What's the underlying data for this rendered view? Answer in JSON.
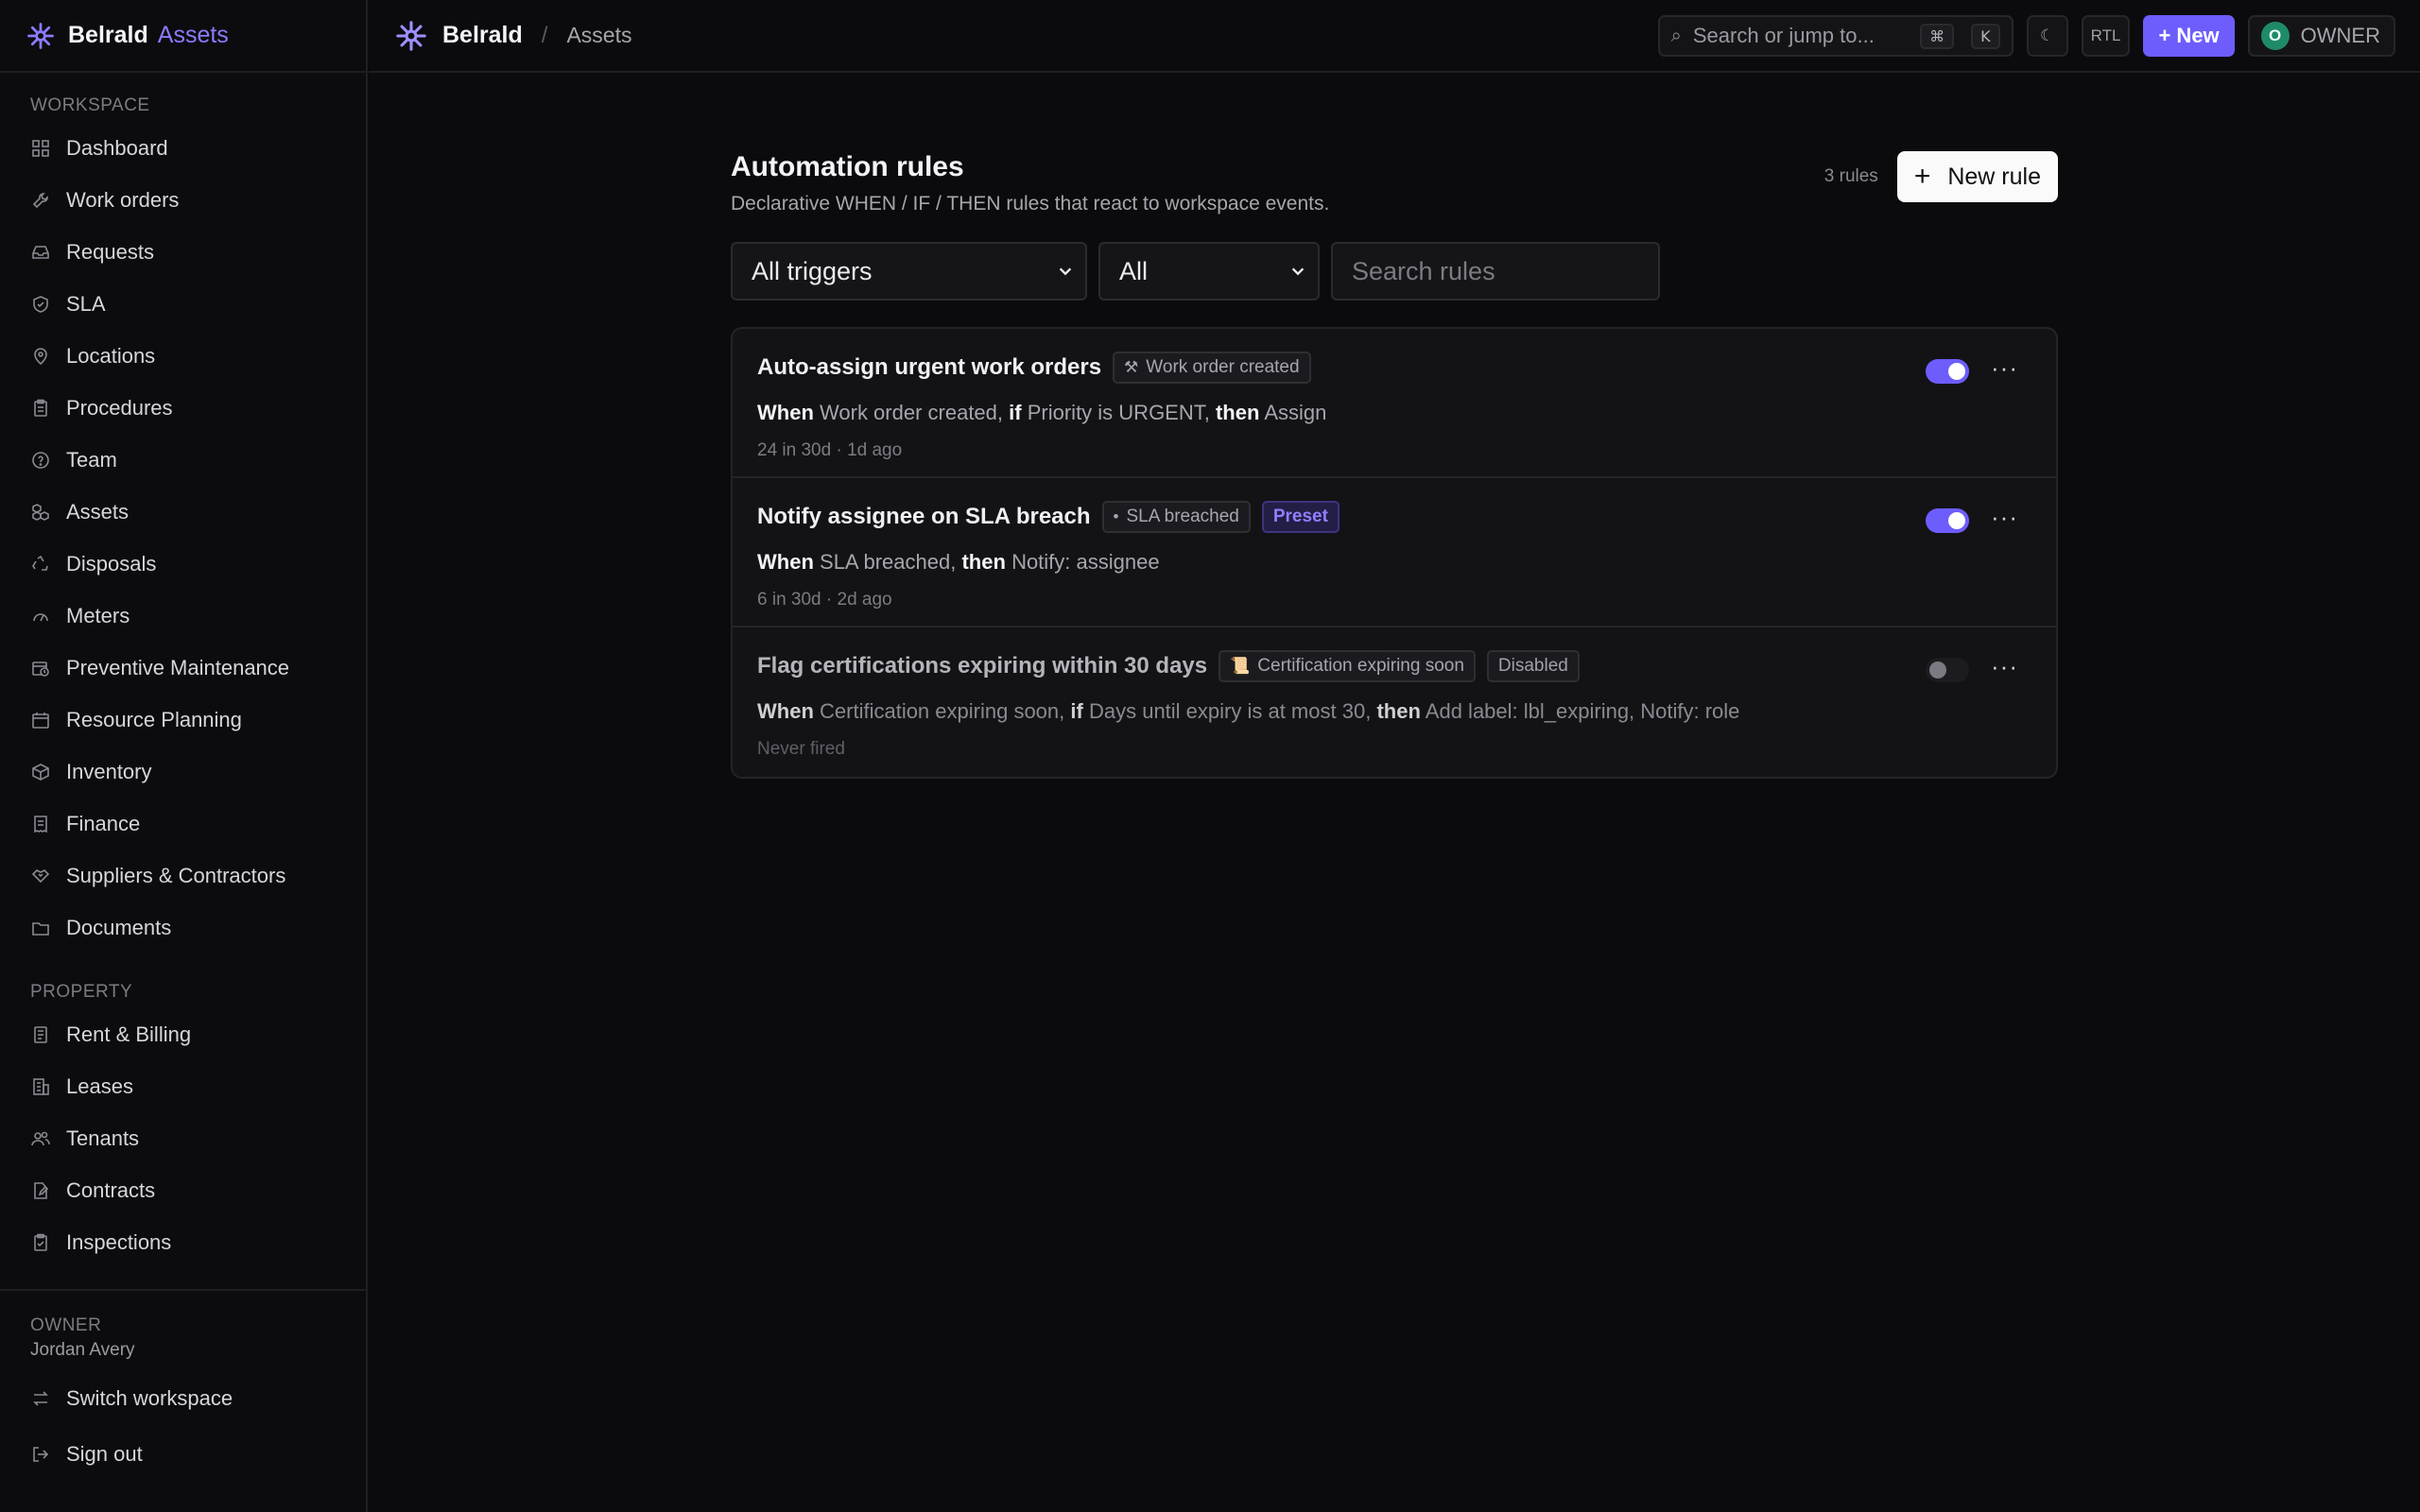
{
  "app": {
    "brand": "Belrald",
    "brand_accent": "Assets"
  },
  "sidebar": {
    "workspace_label": "WORKSPACE",
    "workspace_items": [
      {
        "label": "Dashboard",
        "icon": "grid-icon"
      },
      {
        "label": "Work orders",
        "icon": "wrench-icon"
      },
      {
        "label": "Requests",
        "icon": "inbox-icon"
      },
      {
        "label": "SLA",
        "icon": "shield-icon"
      },
      {
        "label": "Locations",
        "icon": "map-pin-icon"
      },
      {
        "label": "Procedures",
        "icon": "clipboard-icon"
      },
      {
        "label": "Team",
        "icon": "help-circle-icon"
      },
      {
        "label": "Assets",
        "icon": "boxes-icon"
      },
      {
        "label": "Disposals",
        "icon": "recycle-icon"
      },
      {
        "label": "Meters",
        "icon": "gauge-icon"
      },
      {
        "label": "Preventive Maintenance",
        "icon": "calendar-clock-icon"
      },
      {
        "label": "Resource Planning",
        "icon": "calendar-icon"
      },
      {
        "label": "Inventory",
        "icon": "package-icon"
      },
      {
        "label": "Finance",
        "icon": "receipt-icon"
      },
      {
        "label": "Suppliers & Contractors",
        "icon": "handshake-icon"
      },
      {
        "label": "Documents",
        "icon": "folder-icon"
      }
    ],
    "property_label": "PROPERTY",
    "property_items": [
      {
        "label": "Rent & Billing",
        "icon": "receipt-icon"
      },
      {
        "label": "Leases",
        "icon": "building-icon"
      },
      {
        "label": "Tenants",
        "icon": "users-icon"
      },
      {
        "label": "Contracts",
        "icon": "file-edit-icon"
      },
      {
        "label": "Inspections",
        "icon": "clipboard-check-icon"
      }
    ],
    "owner_role": "OWNER",
    "owner_name": "Jordan Avery",
    "switch_workspace": "Switch workspace",
    "sign_out": "Sign out"
  },
  "topbar": {
    "org": "Belrald",
    "separator": "/",
    "page": "Assets",
    "search_placeholder": "Search or jump to...",
    "kbd_cmd": "⌘",
    "kbd_k": "K",
    "theme_icon": "☾",
    "rtl": "RTL",
    "new_label": "+ New",
    "avatar_initial": "O",
    "role": "OWNER"
  },
  "main": {
    "title": "Automation rules",
    "subtitle": "Declarative WHEN / IF / THEN rules that react to workspace events.",
    "count": "3 rules",
    "new_rule": "New rule",
    "filter_trigger": "All triggers",
    "filter_status": "All",
    "search_placeholder": "Search rules"
  },
  "rules": [
    {
      "name": "Auto-assign urgent work orders",
      "trigger_icon": "⚒",
      "trigger": "Work order created",
      "when_kw": "When",
      "when": "Work order created,",
      "if_kw": "if",
      "if": "Priority is URGENT,",
      "then_kw": "then",
      "then": "Assign",
      "meta": "24 in 30d · 1d ago",
      "enabled": true
    },
    {
      "name": "Notify assignee on SLA breach",
      "trigger_icon": "•",
      "trigger": "SLA breached",
      "badge": "Preset",
      "when_kw": "When",
      "when": "SLA breached,",
      "then_kw": "then",
      "then": "Notify: assignee",
      "meta": "6 in 30d · 2d ago",
      "enabled": true
    },
    {
      "name": "Flag certifications expiring within 30 days",
      "trigger_icon": "📜",
      "trigger": "Certification expiring soon",
      "badge": "Disabled",
      "when_kw": "When",
      "when": "Certification expiring soon,",
      "if_kw": "if",
      "if": "Days until expiry is at most 30,",
      "then_kw": "then",
      "then": "Add label: lbl_expiring, Notify: role",
      "meta": "Never fired",
      "enabled": false
    }
  ],
  "colors": {
    "accent": "#6d5dfc",
    "background": "#0b0b0d",
    "card": "#131316"
  }
}
